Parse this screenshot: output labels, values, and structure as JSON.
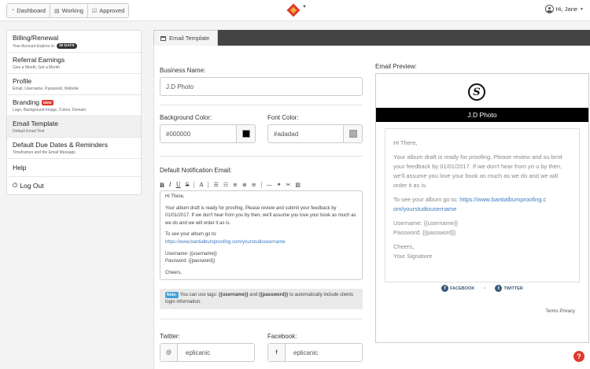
{
  "topnav": {
    "buttons": [
      {
        "label": "Dashboard",
        "icon": "speedometer-icon"
      },
      {
        "label": "Working",
        "icon": "book-icon"
      },
      {
        "label": "Approved",
        "icon": "check-square-icon"
      }
    ],
    "user_label": "Hi, Jane",
    "logo": "brand-logo",
    "colors": {
      "logo_primary": "#e03a2c",
      "logo_secondary": "#f2a93b"
    }
  },
  "sidebar": {
    "items": [
      {
        "title": "Billing/Renewal",
        "subtitle": "Your Account Expires in:",
        "badge": "30 DAYS"
      },
      {
        "title": "Referral Earnings",
        "subtitle": "Give a Month, Get a Month"
      },
      {
        "title": "Profile",
        "subtitle": "Email, Username, Password, Website"
      },
      {
        "title": "Branding",
        "subtitle": "Logo, Background Image, Colors, Domain",
        "badge": "NEW"
      },
      {
        "title": "Email Template",
        "subtitle": "Default Email Text"
      },
      {
        "title": "Default Due Dates & Reminders",
        "subtitle": "Timeframes and the Email Message"
      },
      {
        "title": "Help"
      },
      {
        "title": "Log Out",
        "icon": "power-icon"
      }
    ]
  },
  "tab": {
    "label": "Email Template"
  },
  "form": {
    "business_name_label": "Business Name:",
    "business_name_value": "J.D Photo",
    "bg_color_label": "Background Color:",
    "bg_color_value": "#000000",
    "font_color_label": "Font Color:",
    "font_color_value": "#adadad",
    "notification_label": "Default Notification Email:",
    "email_body": {
      "greeting": "Hi There,",
      "para1": "Your album draft is ready for proofing. Please review and submit your feedback by 01/01/2017. If we don't hear from you by then, we'll assume you love your book as much as we do and we will order it as is.",
      "see_album": "To see your album go to:",
      "url": "https://www.bantialbumproofing.com/yourstudiousername",
      "username": "Username: {{username}}",
      "password": "Password: {{password}}",
      "cheers": "Cheers,"
    },
    "note_tag": "Note:",
    "note_text_1": "You can use tags: ",
    "note_tag_username": "{{username}}",
    "note_text_2": " and ",
    "note_tag_password": "{{password}}",
    "note_text_3": " to automatically include clients login information.",
    "twitter_label": "Twitter:",
    "twitter_prefix": "@",
    "twitter_value": "eplicanic",
    "facebook_label": "Facebook:",
    "facebook_prefix": "f",
    "facebook_value": "eplicanic"
  },
  "preview": {
    "label": "Email Preview:",
    "logo_letter": "S",
    "business_name": "J.D Photo",
    "greeting": "Hi There,",
    "para1": "Your album draft is ready for proofing. Please review and su bmit your feedback by 01/01/2017. If we don't hear from yo u by then, we'll assume you love your book as much as we do and we will order it as is.",
    "see_album": "To see your album go to: ",
    "url": "https://www.bantialbumproofing.c om/yourstudiousername",
    "username": "Username: {{username}}",
    "password": "Password: {{password}}",
    "cheers": "Cheers,",
    "signature": "Your Signature",
    "facebook_label": "FACEBOOK",
    "twitter_label": "TWITTER",
    "terms": "Terms Privacy"
  },
  "help_label": "?"
}
